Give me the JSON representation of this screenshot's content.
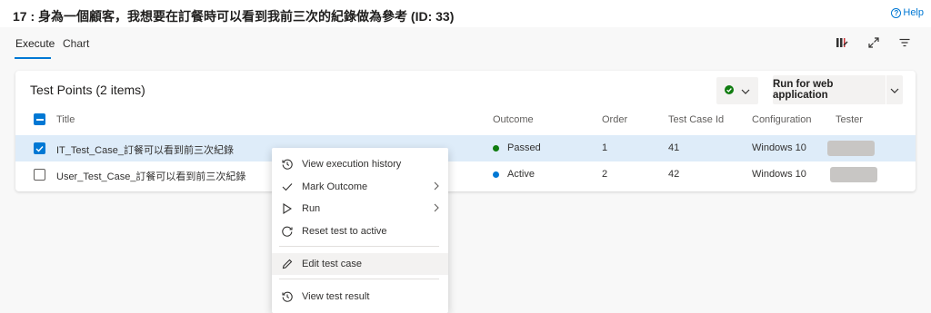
{
  "header": {
    "title": "17 : 身為一個顧客，我想要在訂餐時可以看到我前三次的紀錄做為參考 (ID: 33)",
    "help_label": "Help",
    "help_glyph": "?"
  },
  "tabs": [
    {
      "label": "Execute",
      "active": true
    },
    {
      "label": "Chart",
      "active": false
    }
  ],
  "toolbar": {
    "icons": [
      "column-options-icon",
      "expand-icon",
      "filter-icon"
    ]
  },
  "test_points": {
    "title": "Test Points (2 items)",
    "status_filter_icon": "passed-check-icon",
    "run_label": "Run for web application",
    "columns": [
      "Title",
      "Outcome",
      "Order",
      "Test Case Id",
      "Configuration",
      "Tester"
    ],
    "rows": [
      {
        "title": "IT_Test_Case_訂餐可以看到前三次紀錄",
        "outcome": "Passed",
        "outcome_color": "#107c10",
        "order": "1",
        "test_case_id": "41",
        "configuration": "Windows 10",
        "selected": true
      },
      {
        "title": "User_Test_Case_訂餐可以看到前三次紀錄",
        "outcome": "Active",
        "outcome_color": "#0078d4",
        "order": "2",
        "test_case_id": "42",
        "configuration": "Windows 10",
        "selected": false
      }
    ]
  },
  "context_menu": {
    "items": [
      {
        "label": "View execution history",
        "icon": "history-icon"
      },
      {
        "label": "Mark Outcome",
        "icon": "check-icon",
        "submenu": true
      },
      {
        "label": "Run",
        "icon": "play-icon",
        "submenu": true
      },
      {
        "label": "Reset test to active",
        "icon": "reset-icon"
      },
      {
        "label": "Edit test case",
        "icon": "pencil-icon"
      },
      {
        "label": "View test result",
        "icon": "history-icon"
      }
    ]
  },
  "colors": {
    "accent": "#0078d4",
    "passed": "#107c10",
    "selected_row": "#deecf9"
  }
}
